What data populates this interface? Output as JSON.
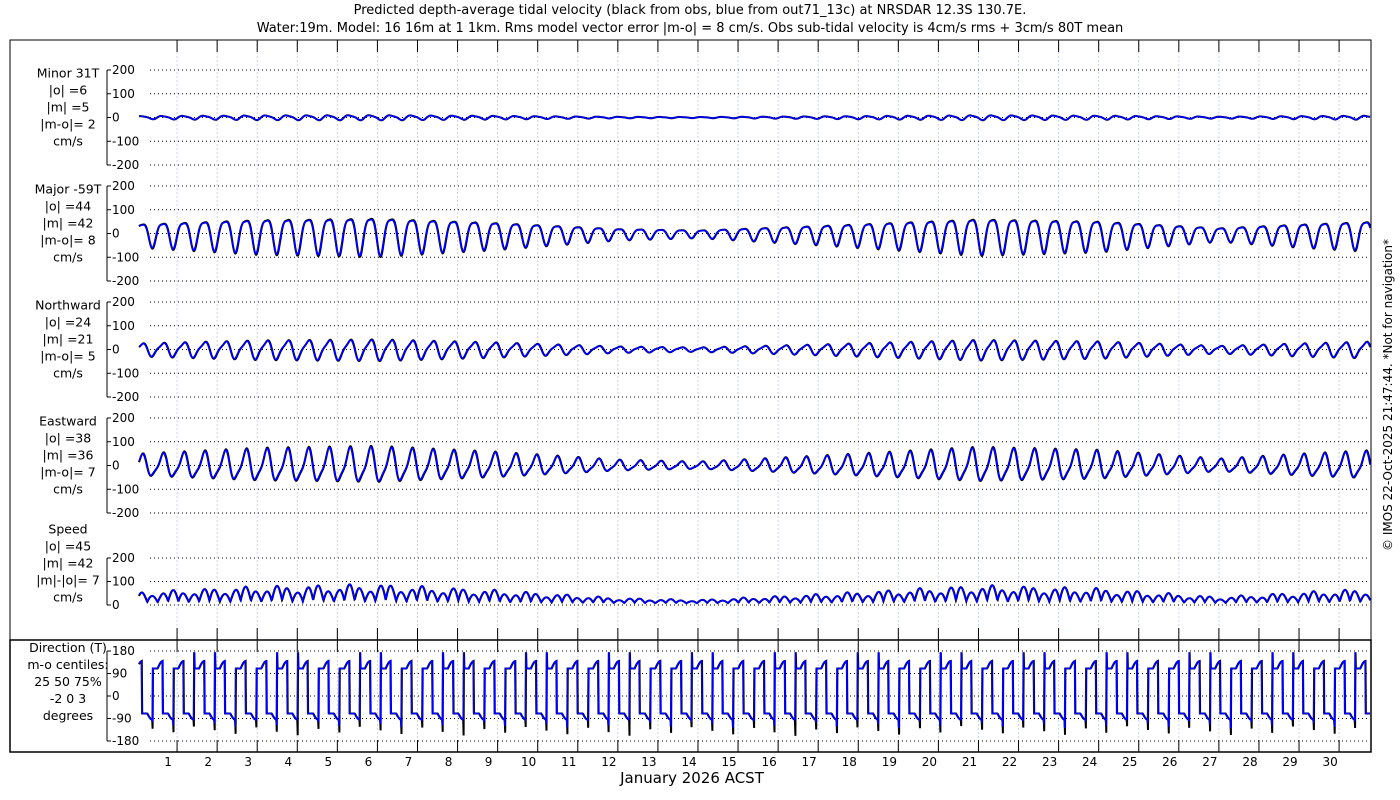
{
  "chart_data": {
    "type": "line",
    "title": "Predicted depth-average tidal velocity (black from obs, blue from out71_13c) at NRSDAR 12.3S 130.7E.",
    "subtitle": "Water:19m. Model: 16 16m at 1 1km. Rms model vector error |m-o| = 8 cm/s. Obs sub-tidal velocity is 4cm/s rms + 3cm/s 80T mean",
    "xlabel": "January 2026 ACST",
    "x_ticks": [
      "1",
      "2",
      "3",
      "4",
      "5",
      "6",
      "7",
      "8",
      "9",
      "10",
      "11",
      "12",
      "13",
      "14",
      "15",
      "16",
      "17",
      "18",
      "19",
      "20",
      "21",
      "22",
      "23",
      "24",
      "25",
      "26",
      "27",
      "28",
      "29",
      "30"
    ],
    "xlim_days": [
      0,
      30.9
    ],
    "series_legend": [
      {
        "name": "obs",
        "color": "#000000"
      },
      {
        "name": "model",
        "color": "#0000ff"
      }
    ],
    "spring_neap_envelope_days": [
      0,
      3,
      6,
      9,
      12,
      14,
      17,
      21,
      24,
      27,
      29,
      31
    ],
    "spring_neap_envelope_rel": [
      0.6,
      0.9,
      1.0,
      0.7,
      0.3,
      0.2,
      0.5,
      0.95,
      0.8,
      0.35,
      0.6,
      0.8
    ],
    "panels": [
      {
        "id": "minor",
        "labels": [
          "Minor 31T",
          "|o| =6",
          "|m| =5",
          "|m-o|= 2",
          "cm/s"
        ],
        "yticks": [
          "200",
          "100",
          "0",
          "-100",
          "-200"
        ],
        "ylim": [
          -200,
          200
        ],
        "amp": 10
      },
      {
        "id": "major",
        "labels": [
          "Major -59T",
          "|o| =44",
          "|m| =42",
          "|m-o|= 8",
          "cm/s"
        ],
        "yticks": [
          "200",
          "100",
          "0",
          "-100",
          "-200"
        ],
        "ylim": [
          -200,
          200
        ],
        "amp": 80
      },
      {
        "id": "north",
        "labels": [
          "Northward",
          "|o| =24",
          "|m| =21",
          "|m-o|= 5",
          "cm/s"
        ],
        "yticks": [
          "200",
          "100",
          "0",
          "-100",
          "-200"
        ],
        "ylim": [
          -200,
          200
        ],
        "amp": 42
      },
      {
        "id": "east",
        "labels": [
          "Eastward",
          "|o| =38",
          "|m| =36",
          "|m-o|= 7",
          "cm/s"
        ],
        "yticks": [
          "200",
          "100",
          "0",
          "-100",
          "-200"
        ],
        "ylim": [
          -200,
          200
        ],
        "amp": 70
      },
      {
        "id": "speed",
        "labels": [
          "Speed",
          "|o| =45",
          "|m| =42",
          "|m|-|o|= 7",
          "cm/s"
        ],
        "yticks": [
          "200",
          "100",
          "0"
        ],
        "ylim": [
          0,
          200
        ],
        "amp": 85
      },
      {
        "id": "direction",
        "labels": [
          "Direction (T)",
          "m-o centiles:",
          "25  50  75%",
          "-2  0  3",
          "degrees"
        ],
        "yticks": [
          "180",
          "90",
          "0",
          "-90",
          "-180"
        ],
        "ylim": [
          -180,
          180
        ]
      }
    ]
  },
  "footer": {
    "credit": "© IMOS 22-Oct-2025 21:47:44. *Not for navigation*"
  }
}
